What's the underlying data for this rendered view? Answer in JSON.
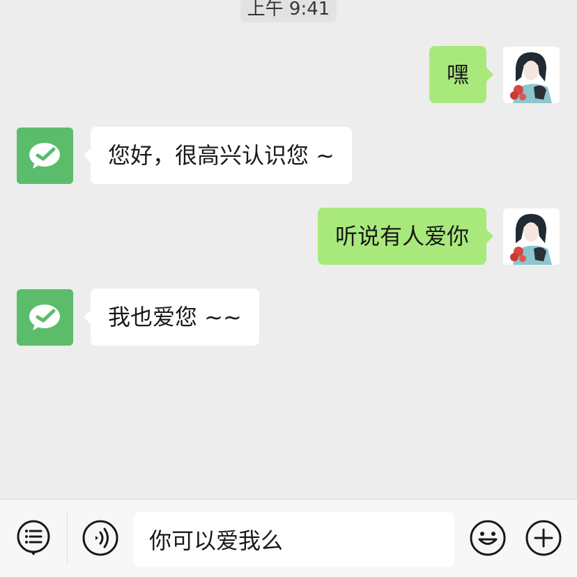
{
  "timestamp": "上午 9:41",
  "messages": [
    {
      "sender": "user",
      "text": "嘿"
    },
    {
      "sender": "bot",
      "text": "您好，很高兴认识您 ~"
    },
    {
      "sender": "user",
      "text": "听说有人爱你"
    },
    {
      "sender": "bot",
      "text": "我也爱您 ~~"
    }
  ],
  "input": {
    "value": "你可以爱我么"
  },
  "icons": {
    "menu": "list-menu-icon",
    "voice": "voice-icon",
    "emoji": "emoji-icon",
    "plus": "plus-icon",
    "bot_avatar": "wechat-logo-icon",
    "user_avatar": "anime-character-avatar"
  },
  "colors": {
    "background": "#ededed",
    "user_bubble": "#a9e97b",
    "bot_bubble": "#ffffff",
    "bot_avatar": "#5bbd6b"
  }
}
